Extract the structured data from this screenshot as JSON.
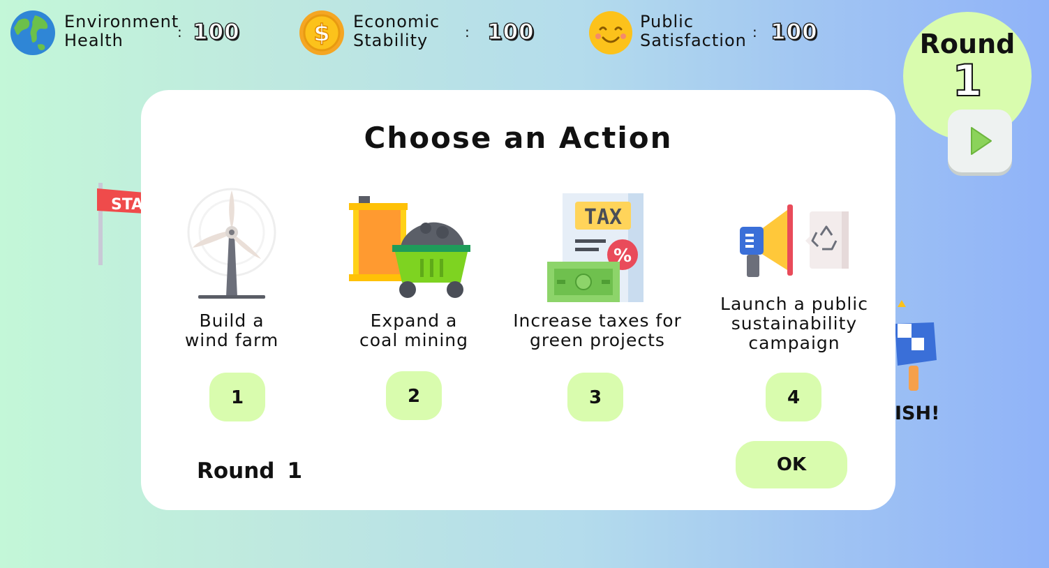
{
  "stats": {
    "environment": {
      "label": "Environment\nHealth",
      "value": "100",
      "icon": "earth-globe-icon"
    },
    "economic": {
      "label": "Economic\nStability",
      "value": "100",
      "icon": "dollar-coin-icon"
    },
    "public": {
      "label": "Public\nSatisfaction",
      "value": "100",
      "icon": "smiley-face-icon"
    },
    "separator": ":"
  },
  "round_badge": {
    "label": "Round",
    "number": "1"
  },
  "background": {
    "flag_text": "STA",
    "finish_text": "ISH!"
  },
  "modal": {
    "title": "Choose an Action",
    "options": [
      {
        "label": "Build a\nwind farm",
        "button": "1",
        "icon": "wind-turbine-icon"
      },
      {
        "label": "Expand a\ncoal mining",
        "button": "2",
        "icon": "coal-mining-icon"
      },
      {
        "label": "Increase taxes for\ngreen projects",
        "button": "3",
        "icon": "tax-document-icon",
        "icon_text": "TAX"
      },
      {
        "label": "Launch a public\nsustainability\ncampaign",
        "button": "4",
        "icon": "megaphone-recycle-icon"
      }
    ],
    "round_label": "Round",
    "round_number": "1",
    "ok_label": "OK"
  }
}
